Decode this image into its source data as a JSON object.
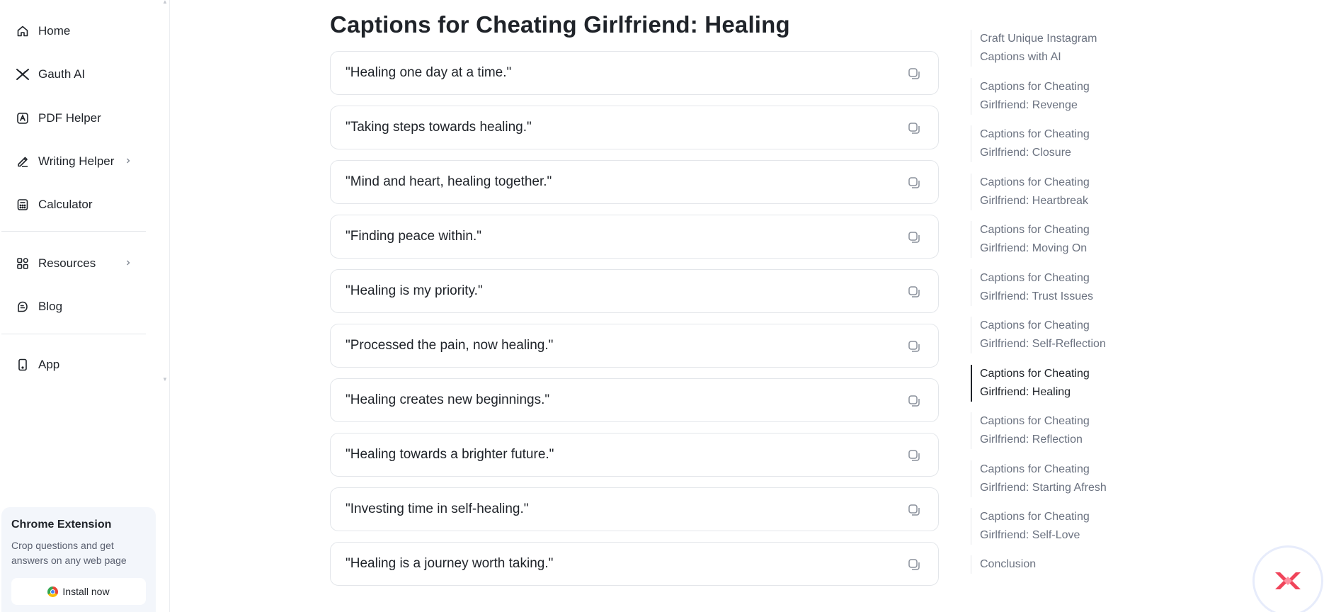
{
  "sidebar": {
    "items": [
      {
        "label": "Home",
        "icon": "home-icon"
      },
      {
        "label": "Gauth AI",
        "icon": "gauth-ai-icon"
      },
      {
        "label": "PDF Helper",
        "icon": "pdf-icon"
      },
      {
        "label": "Writing Helper",
        "icon": "pen-icon",
        "has_submenu": true
      },
      {
        "label": "Calculator",
        "icon": "calculator-icon"
      },
      {
        "label": "Resources",
        "icon": "grid-icon",
        "has_submenu": true
      },
      {
        "label": "Blog",
        "icon": "blog-icon"
      },
      {
        "label": "App",
        "icon": "phone-icon"
      }
    ],
    "extension": {
      "title": "Chrome Extension",
      "description": "Crop questions and get answers on any web page",
      "install_label": "Install now"
    }
  },
  "main": {
    "title": "Captions for Cheating Girlfriend: Healing",
    "captions": [
      "\"Healing one day at a time.\"",
      "\"Taking steps towards healing.\"",
      "\"Mind and heart, healing together.\"",
      "\"Finding peace within.\"",
      "\"Healing is my priority.\"",
      "\"Processed the pain, now healing.\"",
      "\"Healing creates new beginnings.\"",
      "\"Healing towards a brighter future.\"",
      "\"Investing time in self-healing.\"",
      "\"Healing is a journey worth taking.\""
    ]
  },
  "toc": {
    "items": [
      {
        "line1": "Craft Unique Instagram",
        "line2": "Captions with AI",
        "active": false
      },
      {
        "line1": "Captions for Cheating",
        "line2": "Girlfriend: Revenge",
        "active": false
      },
      {
        "line1": "Captions for Cheating",
        "line2": "Girlfriend: Closure",
        "active": false
      },
      {
        "line1": "Captions for Cheating",
        "line2": "Girlfriend: Heartbreak",
        "active": false
      },
      {
        "line1": "Captions for Cheating",
        "line2": "Girlfriend: Moving On",
        "active": false
      },
      {
        "line1": "Captions for Cheating",
        "line2": "Girlfriend: Trust Issues",
        "active": false
      },
      {
        "line1": "Captions for Cheating",
        "line2": "Girlfriend: Self-Reflection",
        "active": false
      },
      {
        "line1": "Captions for Cheating",
        "line2": "Girlfriend: Healing",
        "active": true
      },
      {
        "line1": "Captions for Cheating",
        "line2": "Girlfriend: Reflection",
        "active": false
      },
      {
        "line1": "Captions for Cheating",
        "line2": "Girlfriend: Starting Afresh",
        "active": false
      },
      {
        "line1": "Captions for Cheating",
        "line2": "Girlfriend: Self-Love",
        "active": false
      },
      {
        "line1": "Conclusion",
        "line2": "",
        "active": false
      }
    ]
  },
  "colors": {
    "text": "#1f2329",
    "muted": "#6b7280",
    "border": "#e3e6ea",
    "brand_red": "#f0445a"
  }
}
